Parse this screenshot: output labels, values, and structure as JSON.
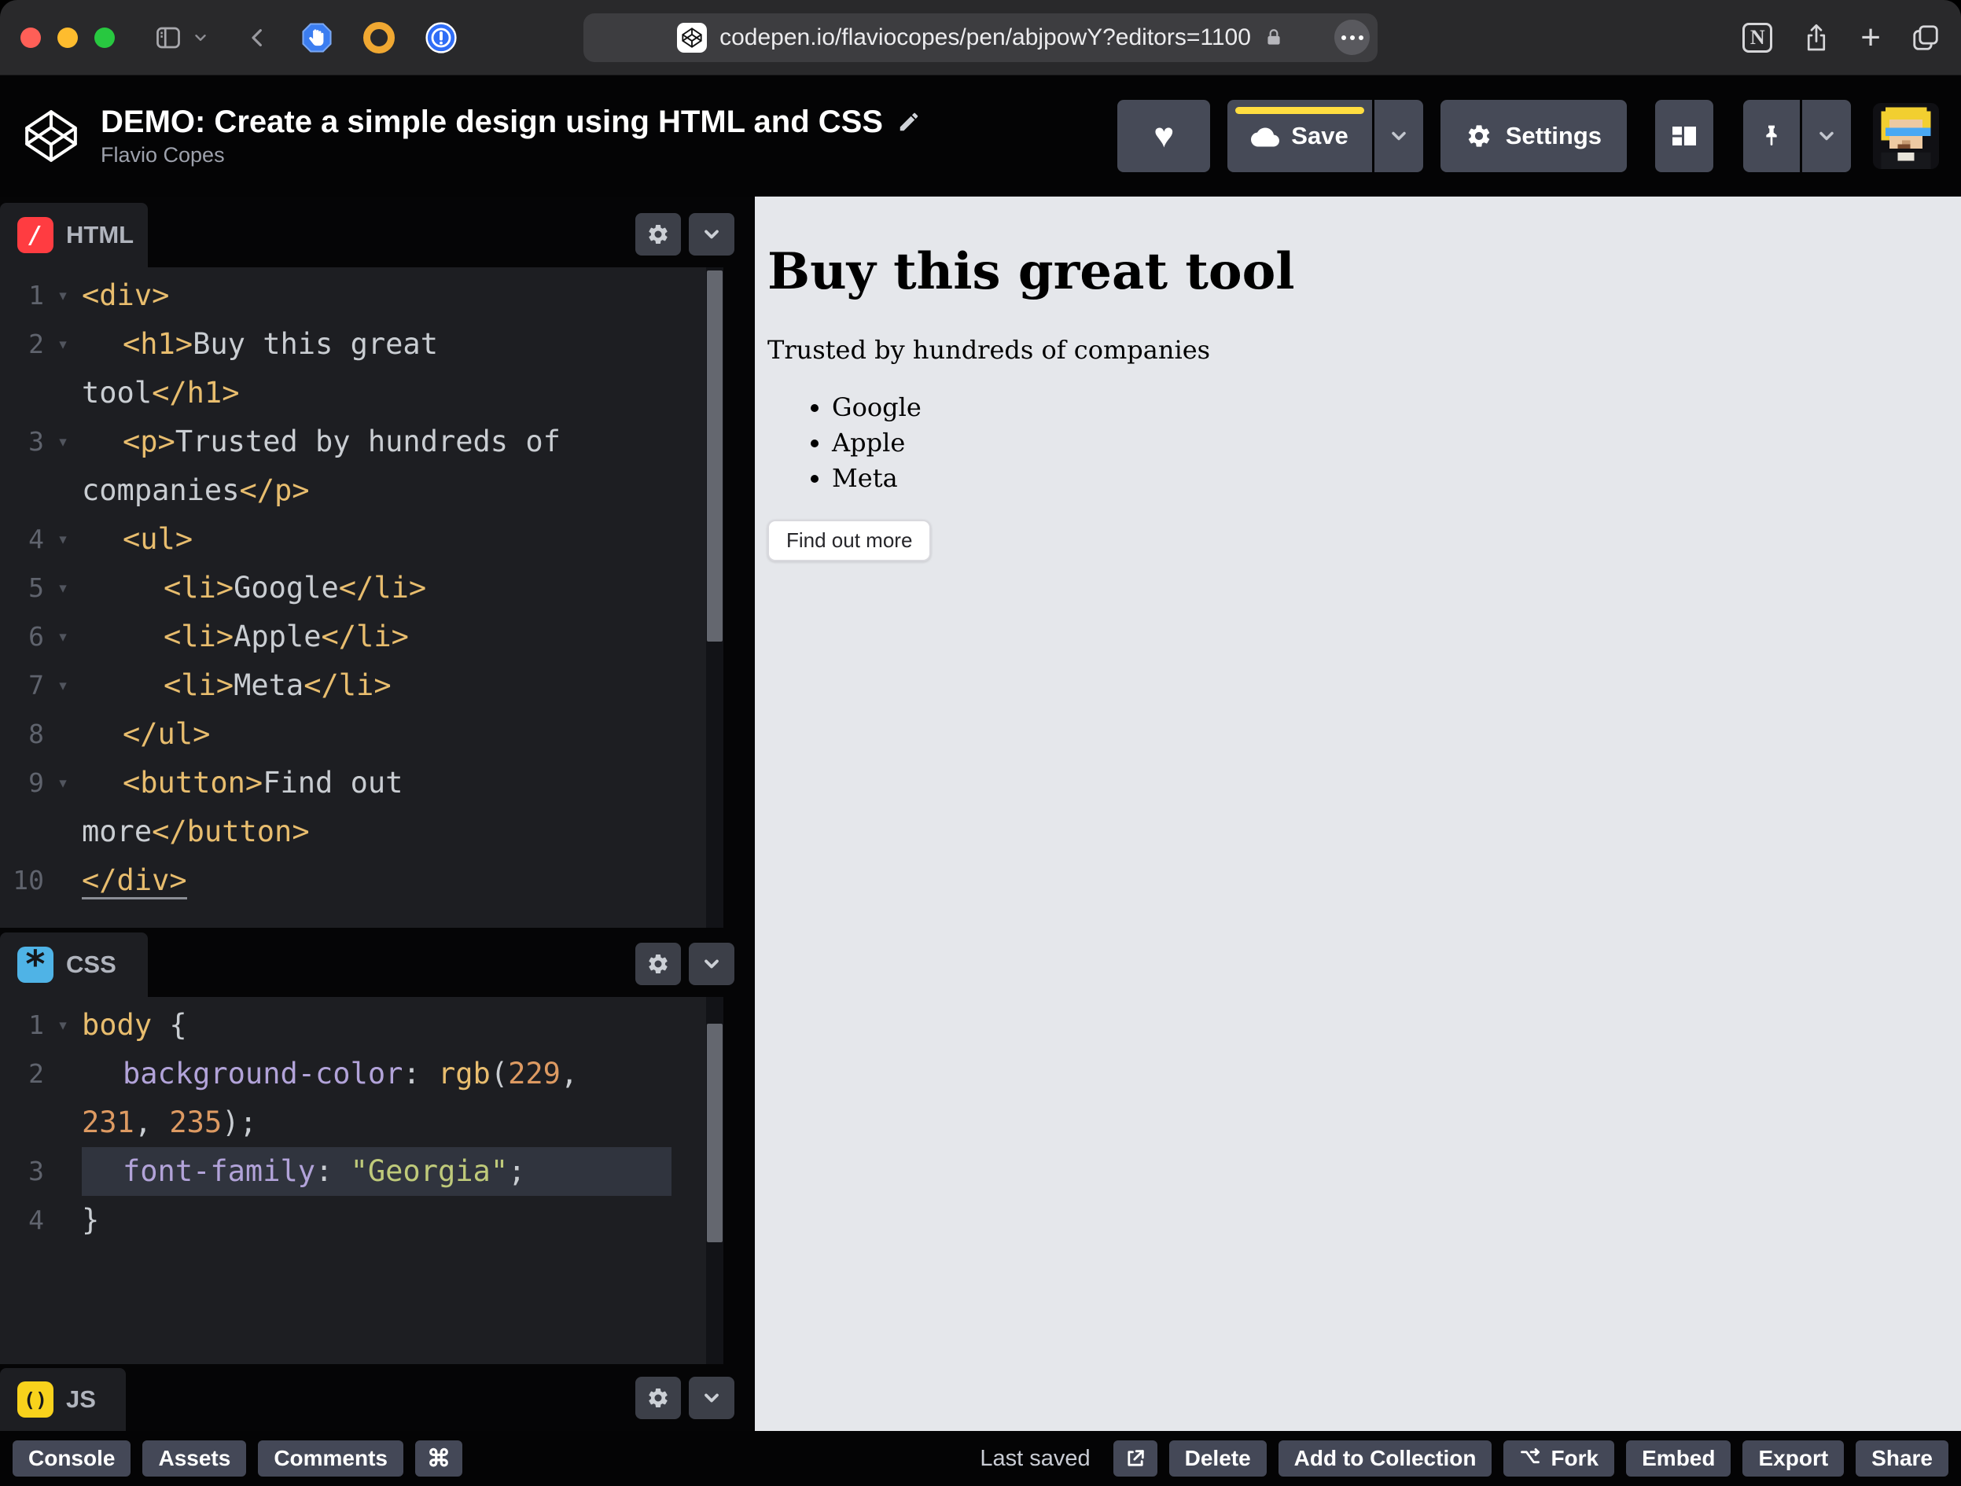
{
  "browser": {
    "url": "codepen.io/flaviocopes/pen/abjpowY?editors=1100",
    "notion_letter": "N",
    "plus_glyph": "+"
  },
  "header": {
    "title": "DEMO: Create a simple design using HTML and CSS",
    "author": "Flavio Copes",
    "heart_glyph": "♥",
    "save_label": "Save",
    "settings_label": "Settings"
  },
  "editors": {
    "html": {
      "label": "HTML",
      "icon_glyph": "/",
      "rows": [
        {
          "n": "1",
          "fold": true,
          "ind": 0,
          "seg": [
            [
              "tag",
              "<div>"
            ]
          ]
        },
        {
          "n": "2",
          "fold": true,
          "ind": 1,
          "seg": [
            [
              "tag",
              "<h1>"
            ],
            [
              "txt",
              "Buy this great"
            ]
          ]
        },
        {
          "n": "",
          "ind": 0,
          "seg": [
            [
              "txt",
              "tool"
            ],
            [
              "tag",
              "</h1>"
            ]
          ]
        },
        {
          "n": "3",
          "fold": true,
          "ind": 1,
          "seg": [
            [
              "tag",
              "<p>"
            ],
            [
              "txt",
              "Trusted by hundreds of"
            ]
          ]
        },
        {
          "n": "",
          "ind": 0,
          "seg": [
            [
              "txt",
              "companies"
            ],
            [
              "tag",
              "</p>"
            ]
          ]
        },
        {
          "n": "4",
          "fold": true,
          "ind": 1,
          "seg": [
            [
              "tag",
              "<ul>"
            ]
          ]
        },
        {
          "n": "5",
          "fold": true,
          "ind": 2,
          "seg": [
            [
              "tag",
              "<li>"
            ],
            [
              "txt",
              "Google"
            ],
            [
              "tag",
              "</li>"
            ]
          ]
        },
        {
          "n": "6",
          "fold": true,
          "ind": 2,
          "seg": [
            [
              "tag",
              "<li>"
            ],
            [
              "txt",
              "Apple"
            ],
            [
              "tag",
              "</li>"
            ]
          ]
        },
        {
          "n": "7",
          "fold": true,
          "ind": 2,
          "seg": [
            [
              "tag",
              "<li>"
            ],
            [
              "txt",
              "Meta"
            ],
            [
              "tag",
              "</li>"
            ]
          ]
        },
        {
          "n": "8",
          "ind": 1,
          "seg": [
            [
              "tag",
              "</ul>"
            ]
          ]
        },
        {
          "n": "9",
          "fold": true,
          "ind": 1,
          "seg": [
            [
              "tag",
              "<button>"
            ],
            [
              "txt",
              "Find out"
            ]
          ]
        },
        {
          "n": "",
          "ind": 0,
          "seg": [
            [
              "txt",
              "more"
            ],
            [
              "tag",
              "</button>"
            ]
          ]
        },
        {
          "n": "10",
          "ind": 0,
          "seg": [
            [
              "tagu",
              "</div>"
            ]
          ]
        }
      ]
    },
    "css": {
      "label": "CSS",
      "icon_glyph": "*",
      "rows": [
        {
          "n": "1",
          "fold": true,
          "ind": 0,
          "seg": [
            [
              "sel",
              "body"
            ],
            [
              "pun",
              " {"
            ]
          ]
        },
        {
          "n": "2",
          "ind": 1,
          "seg": [
            [
              "prop",
              "background-color"
            ],
            [
              "pun",
              ": "
            ],
            [
              "fn",
              "rgb"
            ],
            [
              "pun",
              "("
            ],
            [
              "num",
              "229"
            ],
            [
              "pun",
              ","
            ]
          ]
        },
        {
          "n": "",
          "ind": 0,
          "seg": [
            [
              "num",
              "231"
            ],
            [
              "pun",
              ", "
            ],
            [
              "num",
              "235"
            ],
            [
              "pun",
              ");"
            ]
          ]
        },
        {
          "n": "3",
          "ind": 1,
          "hl": true,
          "seg": [
            [
              "prop",
              "font-family"
            ],
            [
              "pun",
              ": "
            ],
            [
              "str",
              "\"Georgia\""
            ],
            [
              "pun",
              ";"
            ]
          ]
        },
        {
          "n": "4",
          "ind": 0,
          "seg": [
            [
              "pun",
              "}"
            ]
          ]
        }
      ]
    },
    "js": {
      "label": "JS",
      "icon_glyph": "()"
    }
  },
  "preview": {
    "heading": "Buy this great tool",
    "paragraph": "Trusted by hundreds of companies",
    "companies": [
      "Google",
      "Apple",
      "Meta"
    ],
    "button_label": "Find out more"
  },
  "footer": {
    "left": [
      "Console",
      "Assets",
      "Comments",
      "⌘"
    ],
    "status": "Last saved",
    "delete": "Delete",
    "add_to_collection": "Add to Collection",
    "fork": "Fork",
    "embed": "Embed",
    "export": "Export",
    "share": "Share"
  },
  "colors": {
    "save_accent": "#ffdd40",
    "html_icon": "#ff3c41",
    "css_icon": "#4fb3e6",
    "js_icon": "#f8d21c",
    "preview_bg": "#e5e7eb"
  }
}
